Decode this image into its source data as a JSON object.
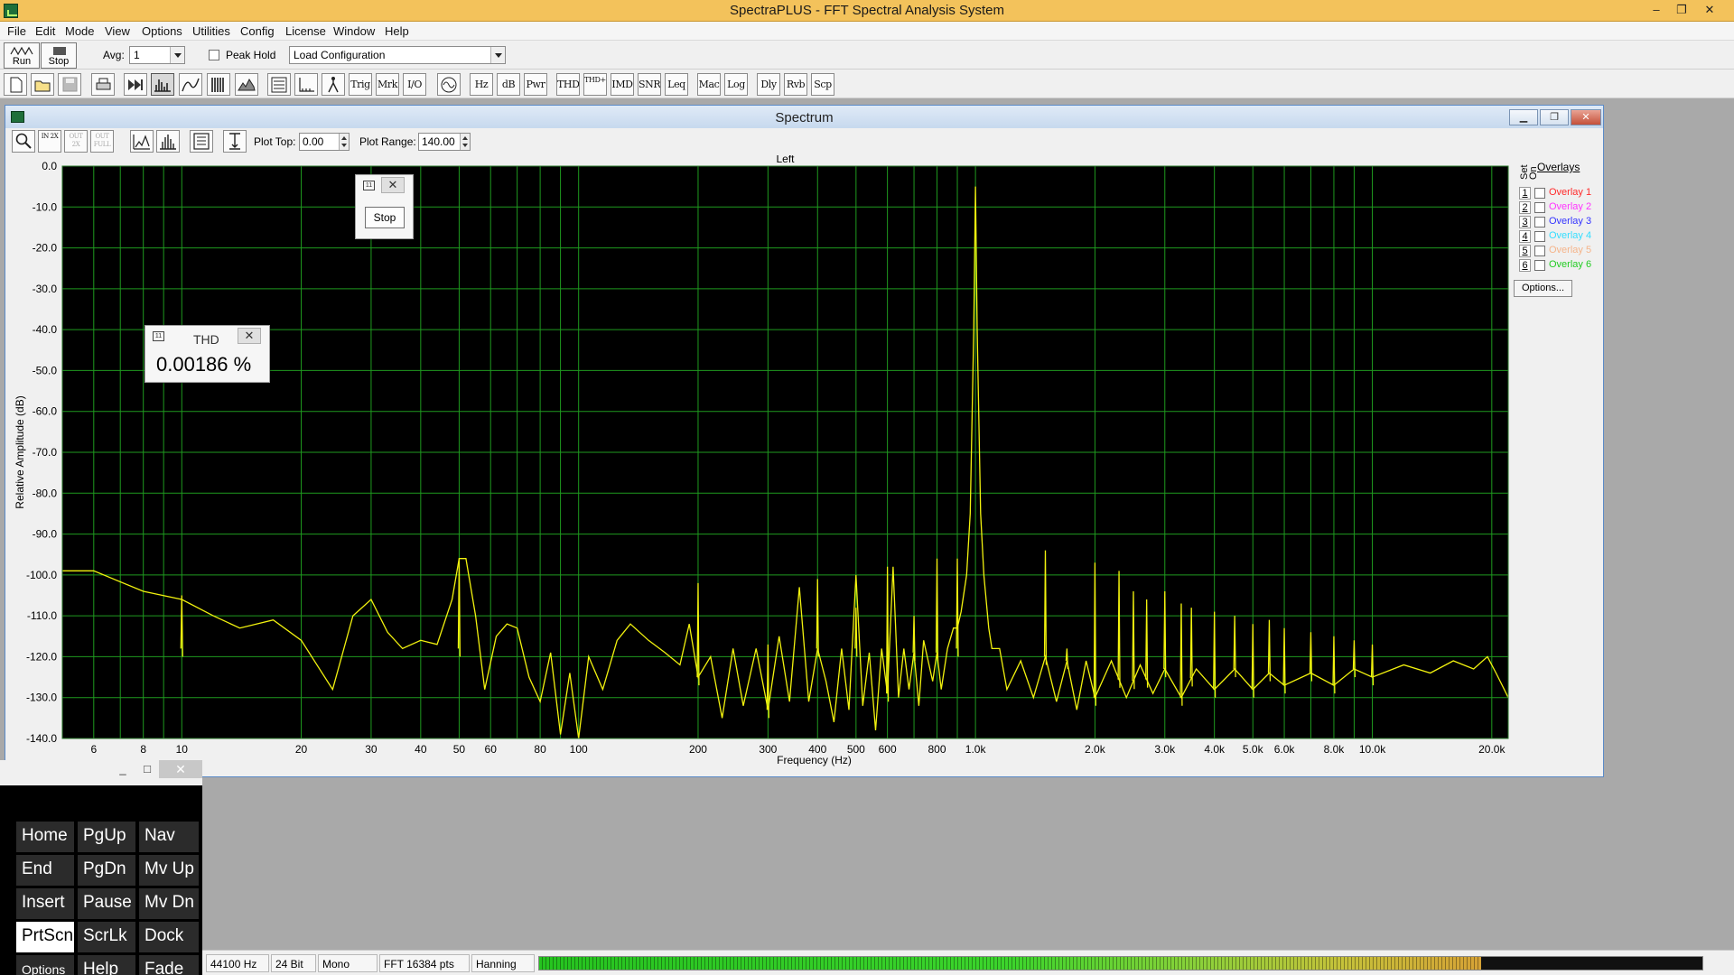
{
  "app": {
    "title": "SpectraPLUS - FFT Spectral Analysis System",
    "window_buttons": {
      "minimize": "–",
      "restore": "❐",
      "close": "✕"
    }
  },
  "menu": [
    "File",
    "Edit",
    "Mode",
    "View",
    "Options",
    "Utilities",
    "Config",
    "License",
    "Window",
    "Help"
  ],
  "toolbar1": {
    "run_label": "Run",
    "stop_label": "Stop",
    "avg_label": "Avg:",
    "avg_value": "1",
    "peak_hold_label": "Peak Hold",
    "peak_hold_checked": false,
    "config_value": "Load Configuration"
  },
  "toolbar2": {
    "buttons": [
      {
        "label": "",
        "icon": "new-file-icon"
      },
      {
        "label": "",
        "icon": "open-folder-icon"
      },
      {
        "label": "",
        "icon": "save-icon"
      },
      {
        "label": "",
        "icon": "print-icon"
      },
      {
        "label": "",
        "icon": "fast-forward-icon"
      },
      {
        "label": "",
        "icon": "spectrum-mode-icon"
      },
      {
        "label": "",
        "icon": "time-series-icon"
      },
      {
        "label": "",
        "icon": "spectrogram-icon"
      },
      {
        "label": "",
        "icon": "3d-surface-icon"
      },
      {
        "label": "",
        "icon": "view-settings-icon"
      },
      {
        "label": "",
        "icon": "axis-icon"
      },
      {
        "label": "",
        "icon": "peak-marker-icon"
      },
      {
        "label": "Trig",
        "icon": ""
      },
      {
        "label": "Mrk",
        "icon": ""
      },
      {
        "label": "I/O",
        "icon": ""
      },
      {
        "label": "",
        "icon": "signal-generator-icon"
      },
      {
        "label": "Hz",
        "icon": ""
      },
      {
        "label": "dB",
        "icon": ""
      },
      {
        "label": "Pwr",
        "icon": ""
      },
      {
        "label": "THD",
        "icon": ""
      },
      {
        "label": "THD+N",
        "icon": ""
      },
      {
        "label": "IMD",
        "icon": ""
      },
      {
        "label": "SNR",
        "icon": ""
      },
      {
        "label": "Leq",
        "icon": ""
      },
      {
        "label": "Mac",
        "icon": ""
      },
      {
        "label": "Log",
        "icon": ""
      },
      {
        "label": "Dly",
        "icon": ""
      },
      {
        "label": "Rvb",
        "icon": ""
      },
      {
        "label": "Scp",
        "icon": ""
      }
    ]
  },
  "spectrum_window": {
    "title": "Spectrum",
    "plot_top_label": "Plot Top:",
    "plot_top_value": "0.00",
    "plot_range_label": "Plot Range:",
    "plot_range_value": "140.00",
    "zoom_in_label": "IN 2X",
    "zoom_out_label": "OUT 2X",
    "zoom_full_label": "OUT FULL"
  },
  "overlays": {
    "header": "Overlays",
    "set_label": "Set",
    "on_label": "On",
    "items": [
      {
        "num": "1",
        "label": "Overlay 1",
        "color": "#ff2a2a"
      },
      {
        "num": "2",
        "label": "Overlay 2",
        "color": "#ff33ff"
      },
      {
        "num": "3",
        "label": "Overlay 3",
        "color": "#3333ff"
      },
      {
        "num": "4",
        "label": "Overlay 4",
        "color": "#33ddff"
      },
      {
        "num": "5",
        "label": "Overlay 5",
        "color": "#f5b48a"
      },
      {
        "num": "6",
        "label": "Overlay 6",
        "color": "#22cc22"
      }
    ],
    "options_label": "Options..."
  },
  "stop_popup": {
    "label": "Stop"
  },
  "thd_popup": {
    "title": "THD",
    "value": "0.00186 %"
  },
  "keyboard": {
    "keys": [
      [
        "Home",
        "PgUp",
        "Nav"
      ],
      [
        "End",
        "PgDn",
        "Mv Up"
      ],
      [
        "Insert",
        "Pause",
        "Mv Dn"
      ],
      [
        "PrtScn",
        "ScrLk",
        "Dock"
      ],
      [
        "Options",
        "Help",
        "Fade"
      ]
    ],
    "highlighted": "PrtScn"
  },
  "status": {
    "sample_rate": "44100 Hz",
    "bits": "24 Bit",
    "channels": "Mono",
    "fft": "FFT 16384 pts",
    "window": "Hanning",
    "level_fraction": 0.81
  },
  "chart_data": {
    "type": "line",
    "title": "Left",
    "xlabel": "Frequency (Hz)",
    "ylabel": "Relative Amplitude (dB)",
    "x_scale": "log",
    "xlim": [
      5,
      22000
    ],
    "ylim": [
      -140,
      0
    ],
    "y_ticks": [
      0,
      -10,
      -20,
      -30,
      -40,
      -50,
      -60,
      -70,
      -80,
      -90,
      -100,
      -110,
      -120,
      -130,
      -140
    ],
    "y_tick_labels": [
      "0.0",
      "-10.0",
      "-20.0",
      "-30.0",
      "-40.0",
      "-50.0",
      "-60.0",
      "-70.0",
      "-80.0",
      "-90.0",
      "-100.0",
      "-110.0",
      "-120.0",
      "-130.0",
      "-140.0"
    ],
    "x_ticks": [
      6,
      8,
      10,
      20,
      30,
      40,
      50,
      60,
      80,
      100,
      200,
      300,
      400,
      500,
      600,
      800,
      1000,
      2000,
      3000,
      4000,
      5000,
      6000,
      8000,
      10000,
      20000
    ],
    "x_tick_labels": [
      "6",
      "8",
      "10",
      "20",
      "30",
      "40",
      "50",
      "60",
      "80",
      "100",
      "200",
      "300",
      "400",
      "500",
      "600",
      "800",
      "1.0k",
      "2.0k",
      "3.0k",
      "4.0k",
      "5.0k",
      "6.0k",
      "8.0k",
      "10.0k",
      "20.0k"
    ],
    "grid": true,
    "background": "#000000",
    "grid_color": "#1f9a1f",
    "series_color": "#f2f20e",
    "series": [
      {
        "points": [
          [
            5,
            -99
          ],
          [
            6,
            -99
          ],
          [
            8,
            -104
          ],
          [
            10,
            -106
          ],
          [
            12,
            -110
          ],
          [
            14,
            -113
          ],
          [
            17,
            -111
          ],
          [
            20,
            -116
          ],
          [
            24,
            -128
          ],
          [
            27,
            -110
          ],
          [
            30,
            -106
          ],
          [
            33,
            -114
          ],
          [
            36,
            -118
          ],
          [
            40,
            -116
          ],
          [
            44,
            -117
          ],
          [
            48,
            -106
          ],
          [
            50,
            -96
          ],
          [
            52,
            -96
          ],
          [
            55,
            -110
          ],
          [
            58,
            -128
          ],
          [
            62,
            -115
          ],
          [
            66,
            -112
          ],
          [
            70,
            -113
          ],
          [
            75,
            -125
          ],
          [
            80,
            -131
          ],
          [
            85,
            -119
          ],
          [
            90,
            -139
          ],
          [
            95,
            -124
          ],
          [
            100,
            -140
          ],
          [
            106,
            -120
          ],
          [
            115,
            -128
          ],
          [
            125,
            -116
          ],
          [
            135,
            -112
          ],
          [
            150,
            -116
          ],
          [
            165,
            -119
          ],
          [
            180,
            -122
          ],
          [
            190,
            -112
          ],
          [
            200,
            -125
          ],
          [
            215,
            -120
          ],
          [
            230,
            -135
          ],
          [
            245,
            -118
          ],
          [
            260,
            -132
          ],
          [
            280,
            -118
          ],
          [
            300,
            -133
          ],
          [
            320,
            -115
          ],
          [
            340,
            -131
          ],
          [
            360,
            -103
          ],
          [
            380,
            -131
          ],
          [
            400,
            -118
          ],
          [
            420,
            -126
          ],
          [
            440,
            -136
          ],
          [
            460,
            -118
          ],
          [
            480,
            -133
          ],
          [
            500,
            -100
          ],
          [
            520,
            -132
          ],
          [
            540,
            -119
          ],
          [
            560,
            -138
          ],
          [
            580,
            -118
          ],
          [
            600,
            -129
          ],
          [
            620,
            -98
          ],
          [
            640,
            -130
          ],
          [
            660,
            -118
          ],
          [
            680,
            -128
          ],
          [
            700,
            -119
          ],
          [
            720,
            -132
          ],
          [
            740,
            -116
          ],
          [
            760,
            -121
          ],
          [
            780,
            -126
          ],
          [
            800,
            -119
          ],
          [
            820,
            -128
          ],
          [
            850,
            -118
          ],
          [
            880,
            -113
          ],
          [
            900,
            -113
          ],
          [
            920,
            -109
          ],
          [
            950,
            -100
          ],
          [
            970,
            -85
          ],
          [
            990,
            -40
          ],
          [
            1000,
            -5
          ],
          [
            1010,
            -40
          ],
          [
            1030,
            -85
          ],
          [
            1050,
            -100
          ],
          [
            1080,
            -113
          ],
          [
            1100,
            -118
          ],
          [
            1150,
            -118
          ],
          [
            1200,
            -128
          ],
          [
            1300,
            -121
          ],
          [
            1400,
            -130
          ],
          [
            1500,
            -120
          ],
          [
            1600,
            -131
          ],
          [
            1700,
            -121
          ],
          [
            1800,
            -133
          ],
          [
            1900,
            -121
          ],
          [
            2000,
            -130
          ],
          [
            2200,
            -121
          ],
          [
            2400,
            -130
          ],
          [
            2600,
            -122
          ],
          [
            2800,
            -129
          ],
          [
            3000,
            -123
          ],
          [
            3300,
            -130
          ],
          [
            3600,
            -123
          ],
          [
            4000,
            -128
          ],
          [
            4500,
            -123
          ],
          [
            5000,
            -128
          ],
          [
            5500,
            -124
          ],
          [
            6000,
            -127
          ],
          [
            7000,
            -124
          ],
          [
            8000,
            -127
          ],
          [
            9000,
            -123
          ],
          [
            10000,
            -125
          ],
          [
            12000,
            -122
          ],
          [
            14000,
            -124
          ],
          [
            16000,
            -121
          ],
          [
            18000,
            -123
          ],
          [
            19500,
            -120
          ],
          [
            20500,
            -124
          ],
          [
            21500,
            -128
          ],
          [
            22000,
            -130
          ]
        ]
      },
      {
        "spikes": [
          [
            10,
            -105
          ],
          [
            50,
            -96
          ],
          [
            200,
            -102
          ],
          [
            300,
            -117
          ],
          [
            400,
            -101
          ],
          [
            500,
            -108
          ],
          [
            600,
            -98
          ],
          [
            700,
            -110
          ],
          [
            800,
            -96
          ],
          [
            900,
            -96
          ],
          [
            1500,
            -94
          ],
          [
            1700,
            -118
          ],
          [
            2000,
            -97
          ],
          [
            2300,
            -99
          ],
          [
            2500,
            -104
          ],
          [
            2700,
            -106
          ],
          [
            3000,
            -104
          ],
          [
            3300,
            -107
          ],
          [
            3500,
            -108
          ],
          [
            4000,
            -109
          ],
          [
            4500,
            -110
          ],
          [
            5000,
            -112
          ],
          [
            5500,
            -111
          ],
          [
            6000,
            -113
          ],
          [
            7000,
            -114
          ],
          [
            8000,
            -115
          ],
          [
            9000,
            -116
          ],
          [
            10000,
            -117
          ]
        ]
      }
    ]
  }
}
